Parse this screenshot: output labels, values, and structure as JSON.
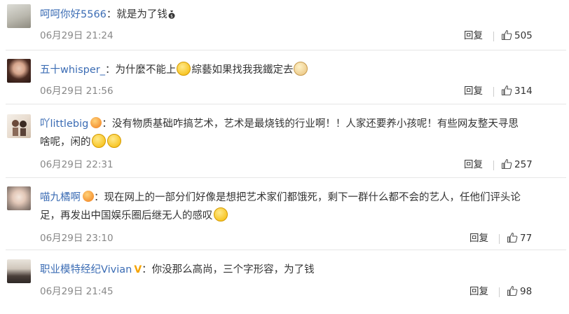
{
  "comments": [
    {
      "username": "呵呵你好5566",
      "text": "：就是为了钱",
      "trailing_emoji": "money-bag-emoji",
      "date": "06月29日 21:24",
      "reply_label": "回复",
      "likes": "505"
    },
    {
      "username": "五十whisper_",
      "text_a": "：为什麼不能上",
      "text_b": "綜藝如果找我我鐵定去",
      "date": "06月29日 21:56",
      "reply_label": "回复",
      "likes": "314"
    },
    {
      "username": "吖littlebig",
      "text_line1": "：没有物质基础咋搞艺术，艺术是最烧钱的行业啊！！人家还要养小孩呢！有些网友整天寻思",
      "text_line2": "啥呢，闲的",
      "date": "06月29日 22:31",
      "reply_label": "回复",
      "likes": "257"
    },
    {
      "username": "喵九橘啊",
      "text_line1": "：现在网上的一部分们好像是想把艺术家们都饿死，剩下一群什么都不会的艺人，任他们评头论",
      "text_line2": "足，再发出中国娱乐圈后继无人的感叹",
      "date": "06月29日 23:10",
      "reply_label": "回复",
      "likes": "77"
    },
    {
      "username": "职业模特经纪Vivian",
      "text": "：你没那么高尚，三个字形容，为了钱",
      "date": "06月29日 21:45",
      "reply_label": "回复",
      "likes": "98"
    }
  ],
  "colors": {
    "username": "#3b6cb4",
    "text": "#333333",
    "meta": "#888888",
    "divider": "#e6e6e6"
  }
}
